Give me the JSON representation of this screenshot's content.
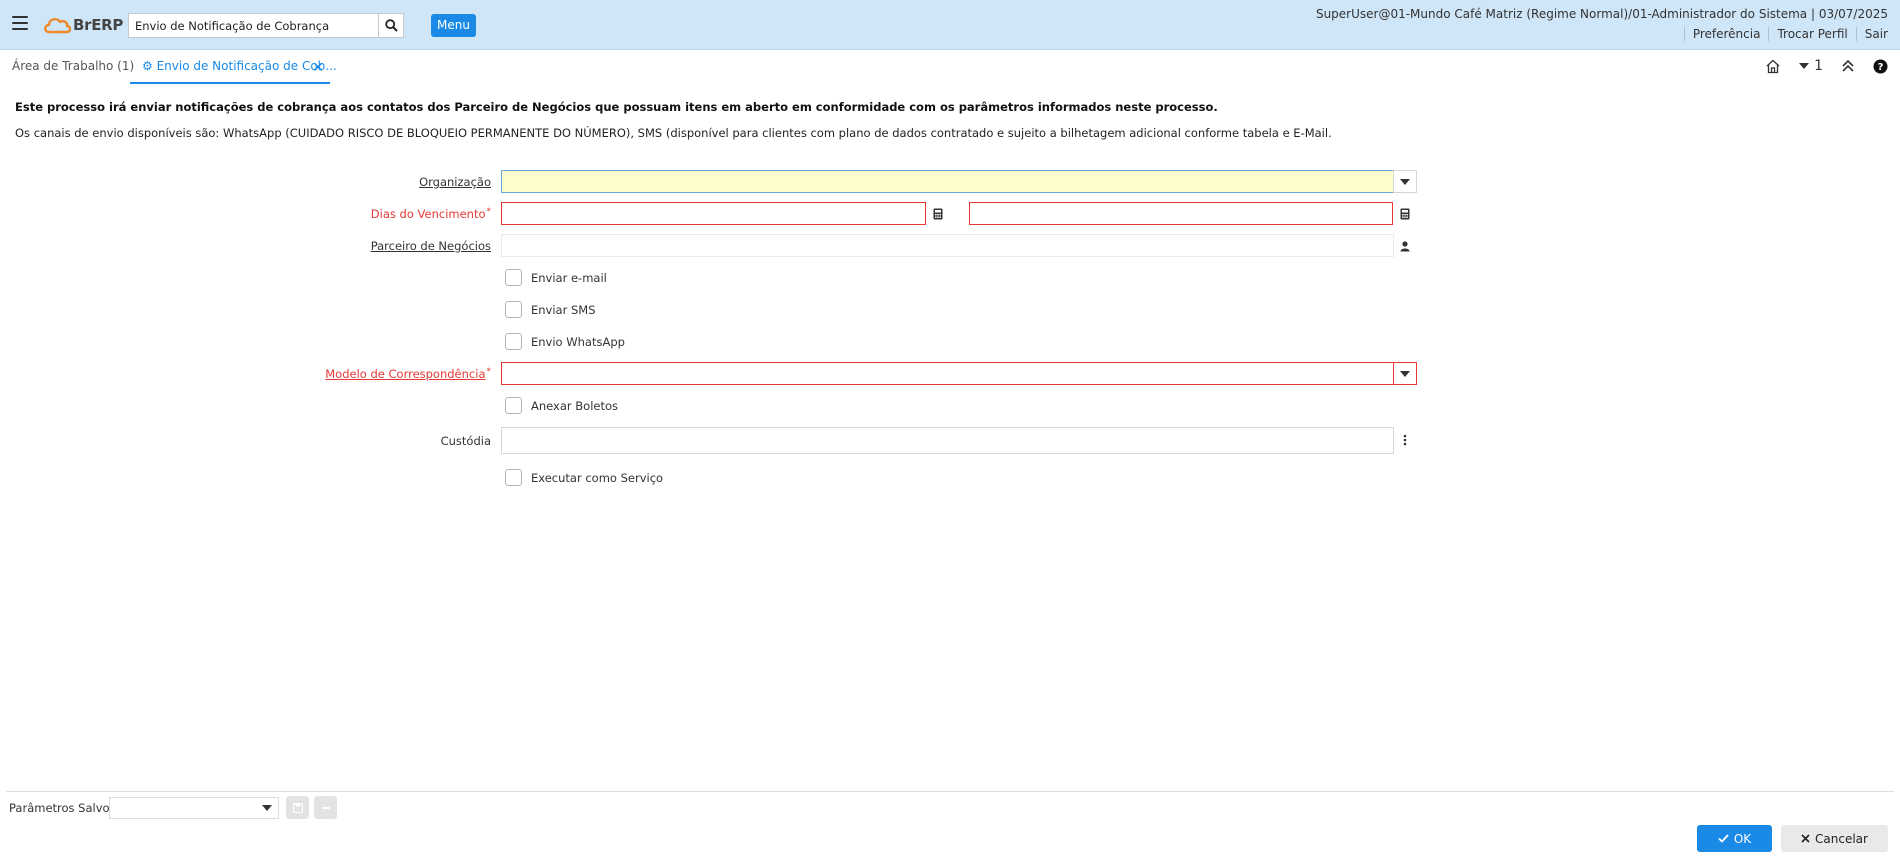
{
  "header": {
    "logo_text": "BrERP",
    "search_value": "Envio de Notificação de Cobrança",
    "menu_label": "Menu",
    "user_info": "SuperUser@01-Mundo Café Matriz (Regime Normal)/01-Administrador do Sistema | 03/07/2025",
    "links": [
      "Preferência",
      "Trocar Perfil",
      "Sair"
    ]
  },
  "tabs": {
    "workspace": "Área de Trabalho (1)",
    "active": "Envio de Notificação de Cob...",
    "window_count": "1"
  },
  "description": {
    "line1": "Este processo irá enviar notificações de cobrança aos contatos dos Parceiro de Negócios que possuam itens em aberto em conformidade com os parâmetros informados neste processo.",
    "line2": "Os canais de envio disponíveis são: WhatsApp (CUIDADO RISCO DE BLOQUEIO PERMANENTE DO NÚMERO), SMS (disponível para clientes com plano de dados contratado e sujeito a bilhetagem adicional conforme tabela e E-Mail."
  },
  "form": {
    "organizacao": {
      "label": "Organização",
      "value": ""
    },
    "dias_vencimento": {
      "label": "Dias do Vencimento",
      "required_mark": "*",
      "value_from": "",
      "value_to": ""
    },
    "parceiro": {
      "label": "Parceiro de Negócios",
      "value": ""
    },
    "enviar_email": "Enviar e-mail",
    "enviar_sms": "Enviar SMS",
    "envio_whatsapp": "Envio WhatsApp",
    "modelo": {
      "label": "Modelo de Correspondência",
      "required_mark": "*",
      "value": ""
    },
    "anexar_boletos": "Anexar Boletos",
    "custodia": {
      "label": "Custódia",
      "value": ""
    },
    "executar_servico": "Executar como Serviço"
  },
  "footer": {
    "saved_params_label": "Parâmetros Salvos",
    "ok_label": "OK",
    "cancel_label": "Cancelar"
  },
  "colors": {
    "header_bg": "#cfe6f8",
    "accent": "#1a8ae6",
    "required": "#e53935",
    "highlight_field": "#fefdcb"
  }
}
